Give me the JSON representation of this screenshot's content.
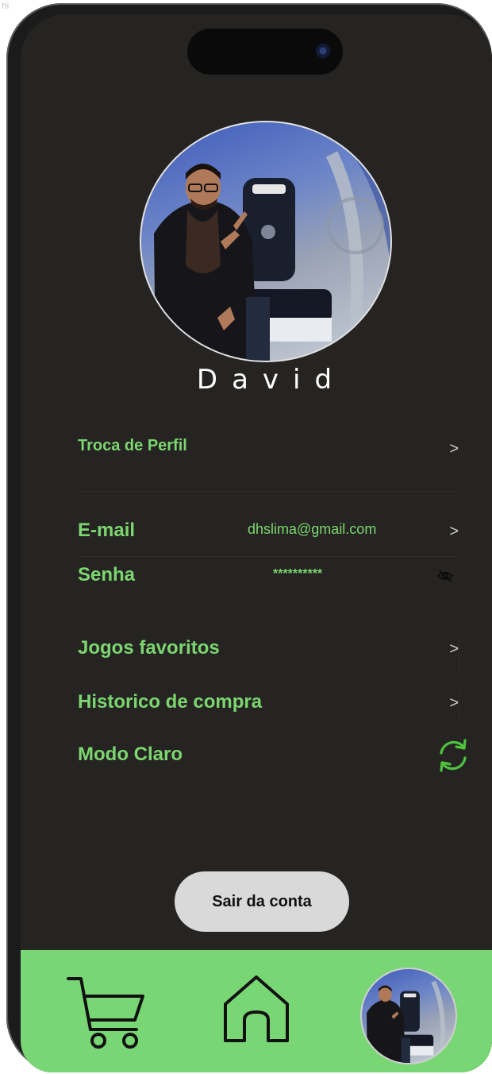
{
  "corner_label": "hi",
  "profile": {
    "name": "David",
    "avatar_icon": "user-avatar-photo"
  },
  "settings": {
    "profile_switch": {
      "label": "Troca de Perfil",
      "chevron": ">"
    },
    "email": {
      "label": "E-mail",
      "value": "dhslima@gmail.com",
      "chevron": ">"
    },
    "password": {
      "label": "Senha",
      "value": "**********",
      "toggle_icon": "eye-off-icon"
    },
    "favorites": {
      "label": "Jogos favoritos",
      "chevron": ">"
    },
    "history": {
      "label": "Historico de compra",
      "chevron": ">"
    },
    "theme": {
      "label": "Modo Claro",
      "toggle_icon": "refresh-icon"
    }
  },
  "logout": {
    "label": "Sair da conta"
  },
  "bottom_nav": {
    "items": [
      {
        "name": "cart",
        "icon": "cart-icon"
      },
      {
        "name": "home",
        "icon": "home-icon"
      },
      {
        "name": "profile",
        "icon": "avatar"
      }
    ]
  },
  "colors": {
    "accent": "#7cd66f",
    "nav_background": "#78d774",
    "screen_background": "#252422",
    "button_background": "#d9d9d9"
  }
}
